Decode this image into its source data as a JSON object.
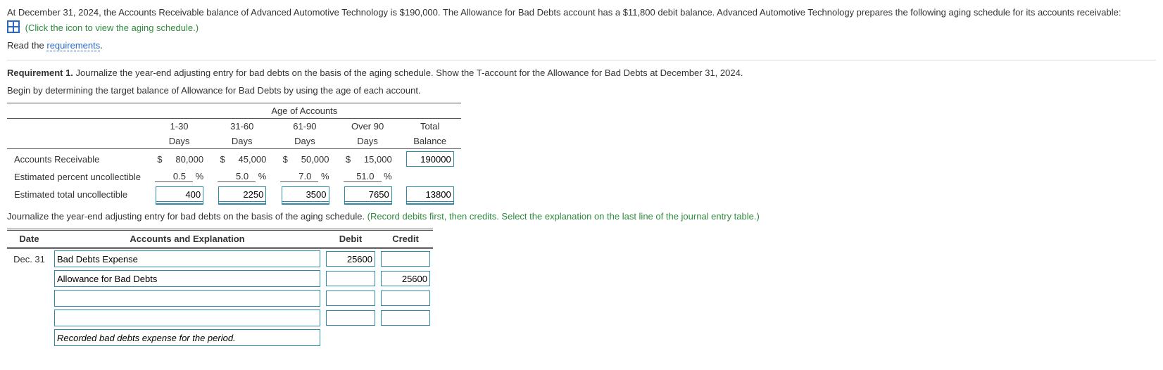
{
  "intro": {
    "problem_text": "At December 31, 2024, the Accounts Receivable balance of Advanced Automotive Technology is $190,000. The Allowance for Bad Debts account has a $11,800 debit balance. Advanced Automotive Technology prepares the following aging schedule for its accounts receivable:",
    "click_hint": "(Click the icon to view the aging schedule.)",
    "read_prefix": "Read the ",
    "requirements_link": "requirements",
    "read_suffix": "."
  },
  "req1": {
    "label": "Requirement 1.",
    "text": " Journalize the year-end adjusting entry for bad debts on the basis of the aging schedule. Show the T-account for the Allowance for Bad Debts at December 31, 2024.",
    "begin_text": "Begin by determining the target balance of Allowance for Bad Debts by using the age of each account."
  },
  "aging": {
    "title": "Age of Accounts",
    "cols": {
      "c1a": "1-30",
      "c1b": "Days",
      "c2a": "31-60",
      "c2b": "Days",
      "c3a": "61-90",
      "c3b": "Days",
      "c4a": "Over 90",
      "c4b": "Days",
      "c5a": "Total",
      "c5b": "Balance"
    },
    "rows": {
      "ar_label": "Accounts Receivable",
      "ar": {
        "c1": "80,000",
        "c2": "45,000",
        "c3": "50,000",
        "c4": "15,000",
        "total": "190000"
      },
      "pct_label": "Estimated percent uncollectible",
      "pct": {
        "c1": "0.5",
        "c2": "5.0",
        "c3": "7.0",
        "c4": "51.0"
      },
      "percent_sign": "%",
      "tot_label": "Estimated total uncollectible",
      "tot": {
        "c1": "400",
        "c2": "2250",
        "c3": "3500",
        "c4": "7650",
        "total": "13800"
      },
      "dollar": "$"
    }
  },
  "journal": {
    "instr_black": "Journalize the year-end adjusting entry for bad debts on the basis of the aging schedule. ",
    "instr_green": "(Record debits first, then credits. Select the explanation on the last line of the journal entry table.)",
    "headers": {
      "date": "Date",
      "acct": "Accounts and Explanation",
      "debit": "Debit",
      "credit": "Credit"
    },
    "date": "Dec. 31",
    "line1_acct": "Bad Debts Expense",
    "line1_debit": "25600",
    "line2_acct": "Allowance for Bad Debts",
    "line2_credit": "25600",
    "expl": "Recorded bad debts expense for the period."
  }
}
